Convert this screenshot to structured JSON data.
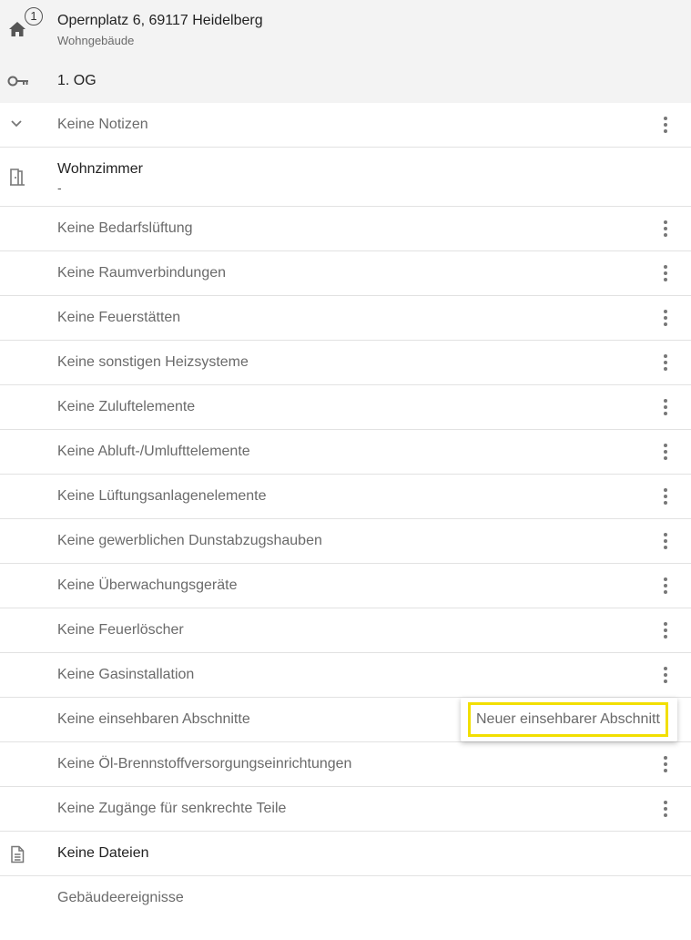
{
  "building": {
    "address": "Opernplatz 6, 69117 Heidelberg",
    "type": "Wohngebäude",
    "badge": "1"
  },
  "floor": {
    "label": "1. OG"
  },
  "notes": {
    "label": "Keine Notizen"
  },
  "room": {
    "title": "Wohnzimmer",
    "subtitle": "-"
  },
  "sections": [
    "Keine Bedarfslüftung",
    "Keine Raumverbindungen",
    "Keine Feuerstätten",
    "Keine sonstigen Heizsysteme",
    "Keine Zuluftelemente",
    "Keine Abluft-/Umlufttelemente",
    "Keine Lüftungsanlagenelemente",
    "Keine gewerblichen Dunstabzugshauben",
    "Keine Überwachungsgeräte",
    "Keine Feuerlöscher",
    "Keine Gasinstallation",
    "Keine einsehbaren Abschnitte",
    "Keine Öl-Brennstoffversorgungseinrichtungen",
    "Keine Zugänge für senkrechte Teile"
  ],
  "files": {
    "label": "Keine Dateien"
  },
  "events": {
    "label": "Gebäudeereignisse"
  },
  "popup": {
    "item_label": "Neuer einsehbarer Abschnitt"
  },
  "icons": {
    "home": "home-icon",
    "key": "key-icon",
    "chevron": "chevron-down-icon",
    "door": "door-icon",
    "file": "file-icon",
    "menu": "more-vertical-icon"
  },
  "colors": {
    "highlight": "#f2df00",
    "header_bg": "#f3f3f3"
  }
}
